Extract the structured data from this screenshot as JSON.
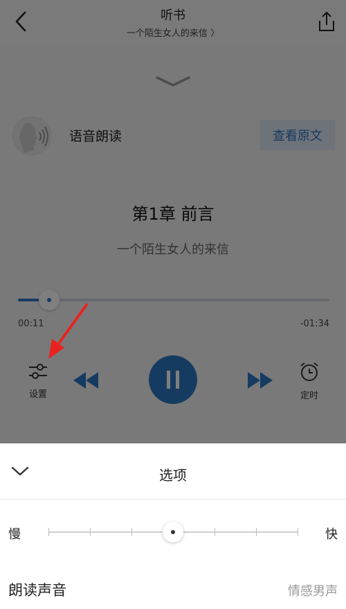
{
  "header": {
    "title": "听书",
    "subtitle": "一个陌生女人的来信",
    "subtitle_chevron": "〉"
  },
  "player": {
    "reader_name": "语音朗读",
    "view_original_label": "查看原文",
    "chapter_title": "第1章 前言",
    "book_title": "一个陌生女人的来信",
    "elapsed": "00:11",
    "remaining": "-01:34",
    "progress_percent": 10,
    "settings_label": "设置",
    "timer_label": "定时",
    "is_playing": true
  },
  "sheet": {
    "title": "选项",
    "slow_label": "慢",
    "fast_label": "快",
    "speed_steps": 7,
    "speed_index": 3,
    "voice_label": "朗读声音",
    "voice_value": "情感男声"
  },
  "colors": {
    "accent": "#2d76c2",
    "annotation": "#e8231f"
  }
}
